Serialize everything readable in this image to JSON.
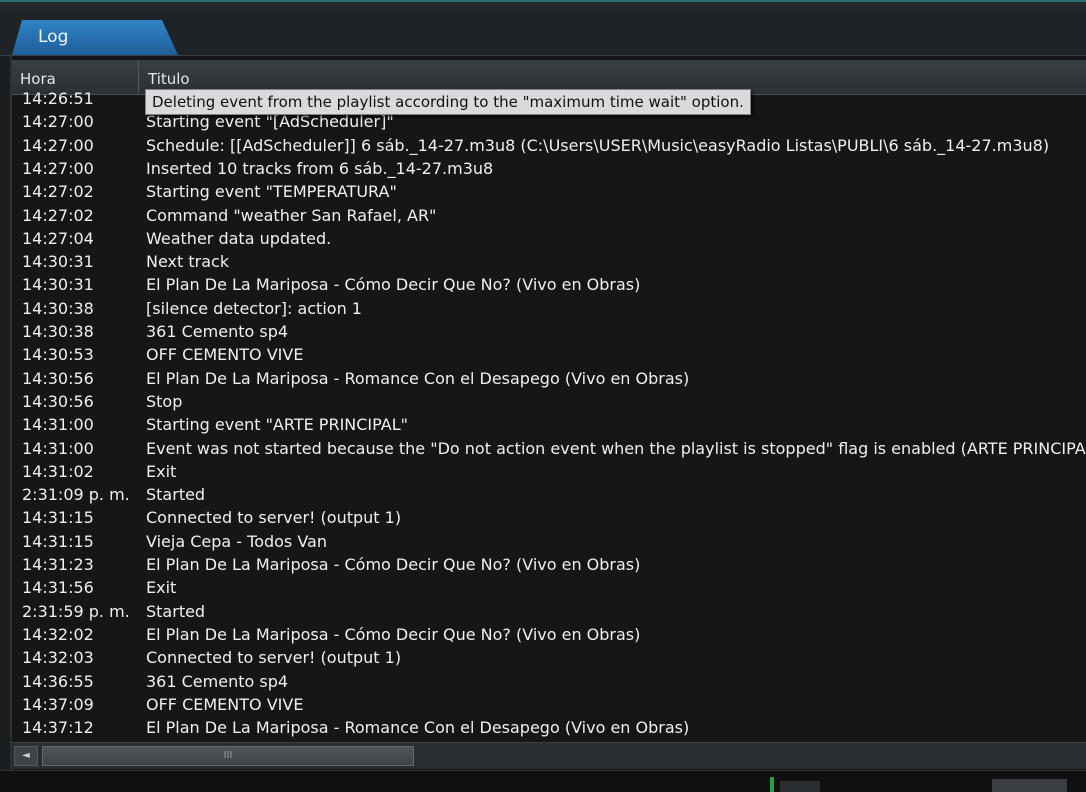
{
  "tab": {
    "label": "Log"
  },
  "columns": {
    "hora": "Hora",
    "titulo": "Titulo"
  },
  "tooltip": "Deleting event from the playlist according to the \"maximum time wait\" option.",
  "rows": [
    {
      "hora": "14:26:51",
      "titulo": ""
    },
    {
      "hora": "14:27:00",
      "titulo": "Starting event \"[AdScheduler]\""
    },
    {
      "hora": "14:27:00",
      "titulo": "Schedule: [[AdScheduler]] 6 sáb._14-27.m3u8 (C:\\Users\\USER\\Music\\easyRadio Listas\\PUBLI\\6 sáb._14-27.m3u8)"
    },
    {
      "hora": "14:27:00",
      "titulo": "Inserted 10 tracks from 6 sáb._14-27.m3u8"
    },
    {
      "hora": "14:27:02",
      "titulo": "Starting event \"TEMPERATURA\""
    },
    {
      "hora": "14:27:02",
      "titulo": "Command \"weather San Rafael, AR\""
    },
    {
      "hora": "14:27:04",
      "titulo": "Weather data updated."
    },
    {
      "hora": "14:30:31",
      "titulo": "Next track"
    },
    {
      "hora": "14:30:31",
      "titulo": "El Plan De La Mariposa - Cómo Decir Que No? (Vivo en Obras)"
    },
    {
      "hora": "14:30:38",
      "titulo": "[silence detector]: action 1"
    },
    {
      "hora": "14:30:38",
      "titulo": "361 Cemento sp4"
    },
    {
      "hora": "14:30:53",
      "titulo": "OFF CEMENTO VIVE"
    },
    {
      "hora": "14:30:56",
      "titulo": "El Plan De La Mariposa - Romance Con el Desapego (Vivo en Obras)"
    },
    {
      "hora": "14:30:56",
      "titulo": "Stop"
    },
    {
      "hora": "14:31:00",
      "titulo": "Starting event \"ARTE PRINCIPAL\""
    },
    {
      "hora": "14:31:00",
      "titulo": "Event was not started because the \"Do not action event when the playlist is stopped\" flag is enabled (ARTE PRINCIPAL)"
    },
    {
      "hora": "14:31:02",
      "titulo": "Exit"
    },
    {
      "hora": "2:31:09 p. m.",
      "titulo": "Started"
    },
    {
      "hora": "14:31:15",
      "titulo": "Connected to server! (output 1)"
    },
    {
      "hora": "14:31:15",
      "titulo": "Vieja Cepa - Todos Van"
    },
    {
      "hora": "14:31:23",
      "titulo": "El Plan De La Mariposa - Cómo Decir Que No? (Vivo en Obras)"
    },
    {
      "hora": "14:31:56",
      "titulo": "Exit"
    },
    {
      "hora": "2:31:59 p. m.",
      "titulo": "Started"
    },
    {
      "hora": "14:32:02",
      "titulo": "El Plan De La Mariposa - Cómo Decir Que No? (Vivo en Obras)"
    },
    {
      "hora": "14:32:03",
      "titulo": "Connected to server! (output 1)"
    },
    {
      "hora": "14:36:55",
      "titulo": "361 Cemento sp4"
    },
    {
      "hora": "14:37:09",
      "titulo": "OFF CEMENTO VIVE"
    },
    {
      "hora": "14:37:12",
      "titulo": "El Plan De La Mariposa - Romance Con el Desapego (Vivo en Obras)"
    }
  ],
  "scrollbar": {
    "left_arrow": "◄",
    "thumb_grip": "III"
  },
  "colors": {
    "tab": "#2f84c6",
    "status": "#25a045"
  }
}
